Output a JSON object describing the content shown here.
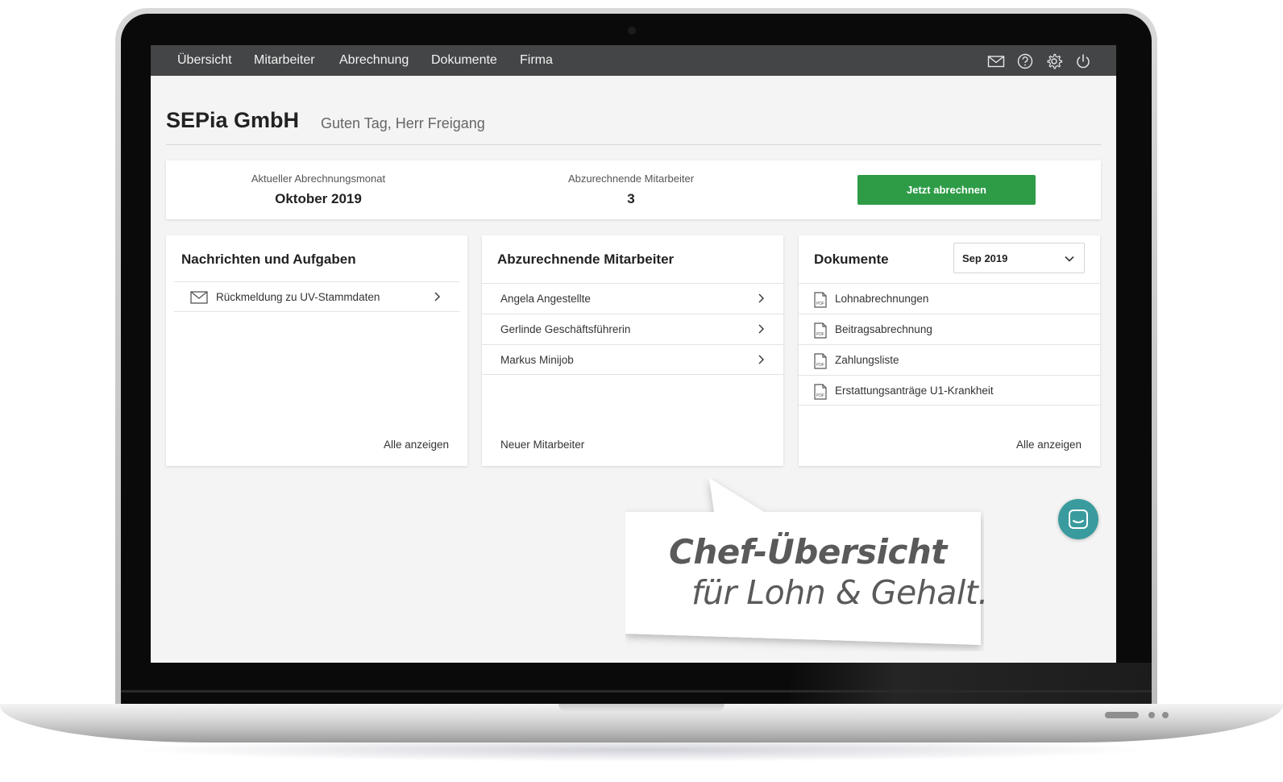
{
  "nav": {
    "items": [
      "Übersicht",
      "Mitarbeiter",
      "Abrechnung",
      "Dokumente",
      "Firma"
    ],
    "icons": [
      "mail-icon",
      "help-icon",
      "gear-icon",
      "power-icon"
    ]
  },
  "header": {
    "company": "SEPia GmbH",
    "greeting": "Guten Tag, Herr Freigang"
  },
  "summary": {
    "month_label": "Aktueller Abrechnungsmonat",
    "month_value": "Oktober 2019",
    "employees_label": "Abzurechnende Mitarbeiter",
    "employees_value": "3",
    "cta_label": "Jetzt abrechnen"
  },
  "messages": {
    "title": "Nachrichten und Aufgaben",
    "items": [
      "Rückmeldung zu UV-Stammdaten"
    ],
    "link": "Alle anzeigen"
  },
  "employees": {
    "title": "Abzurechnende Mitarbeiter",
    "items": [
      "Angela Angestellte",
      "Gerlinde Geschäftsführerin",
      "Markus Minijob"
    ],
    "link": "Neuer Mitarbeiter"
  },
  "documents": {
    "title": "Dokumente",
    "period": "Sep 2019",
    "items": [
      "Lohnabrechnungen",
      "Beitragsabrechnung",
      "Zahlungsliste",
      "Erstattungsanträge U1-Krankheit"
    ],
    "link": "Alle anzeigen"
  },
  "tagline": {
    "line1": "Chef-Übersicht",
    "line2": "für Lohn & Gehalt."
  },
  "colors": {
    "nav_bg": "#444547",
    "cta": "#2e9c47",
    "chat": "#3a9b9e"
  }
}
